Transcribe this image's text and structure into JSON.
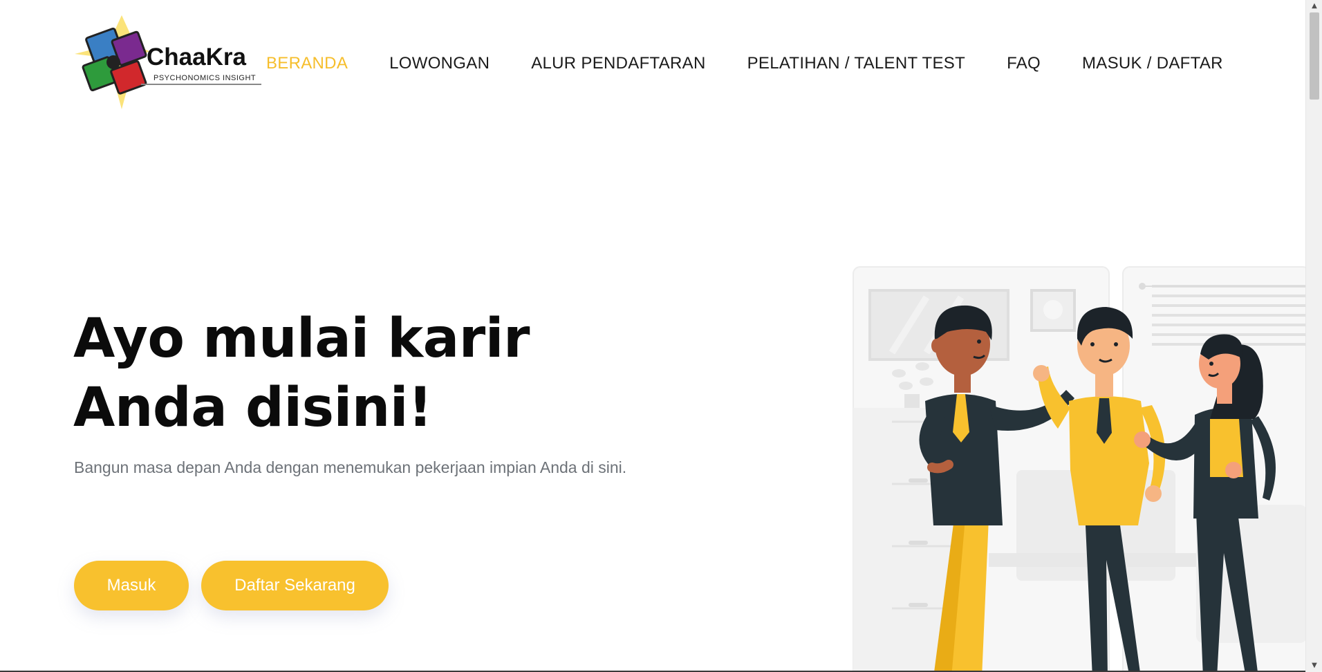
{
  "brand": {
    "name": "ChaaKra",
    "tagline": "PSYCHONOMICS INSIGHT"
  },
  "nav": {
    "items": [
      {
        "label": "BERANDA",
        "active": true
      },
      {
        "label": "LOWONGAN",
        "active": false
      },
      {
        "label": "ALUR PENDAFTARAN",
        "active": false
      },
      {
        "label": "PELATIHAN / TALENT TEST",
        "active": false
      },
      {
        "label": "FAQ",
        "active": false
      },
      {
        "label": "MASUK / DAFTAR",
        "active": false
      }
    ]
  },
  "hero": {
    "title_line1": "Ayo mulai karir",
    "title_line2": "Anda disini!",
    "subtitle": "Bangun masa depan Anda dengan menemukan pekerjaan impian Anda di sini.",
    "login_label": "Masuk",
    "register_label": "Daftar Sekarang"
  },
  "colors": {
    "accent": "#f8c12e",
    "dark": "#26333a",
    "text": "#1b1b1b",
    "muted": "#6d7278"
  }
}
